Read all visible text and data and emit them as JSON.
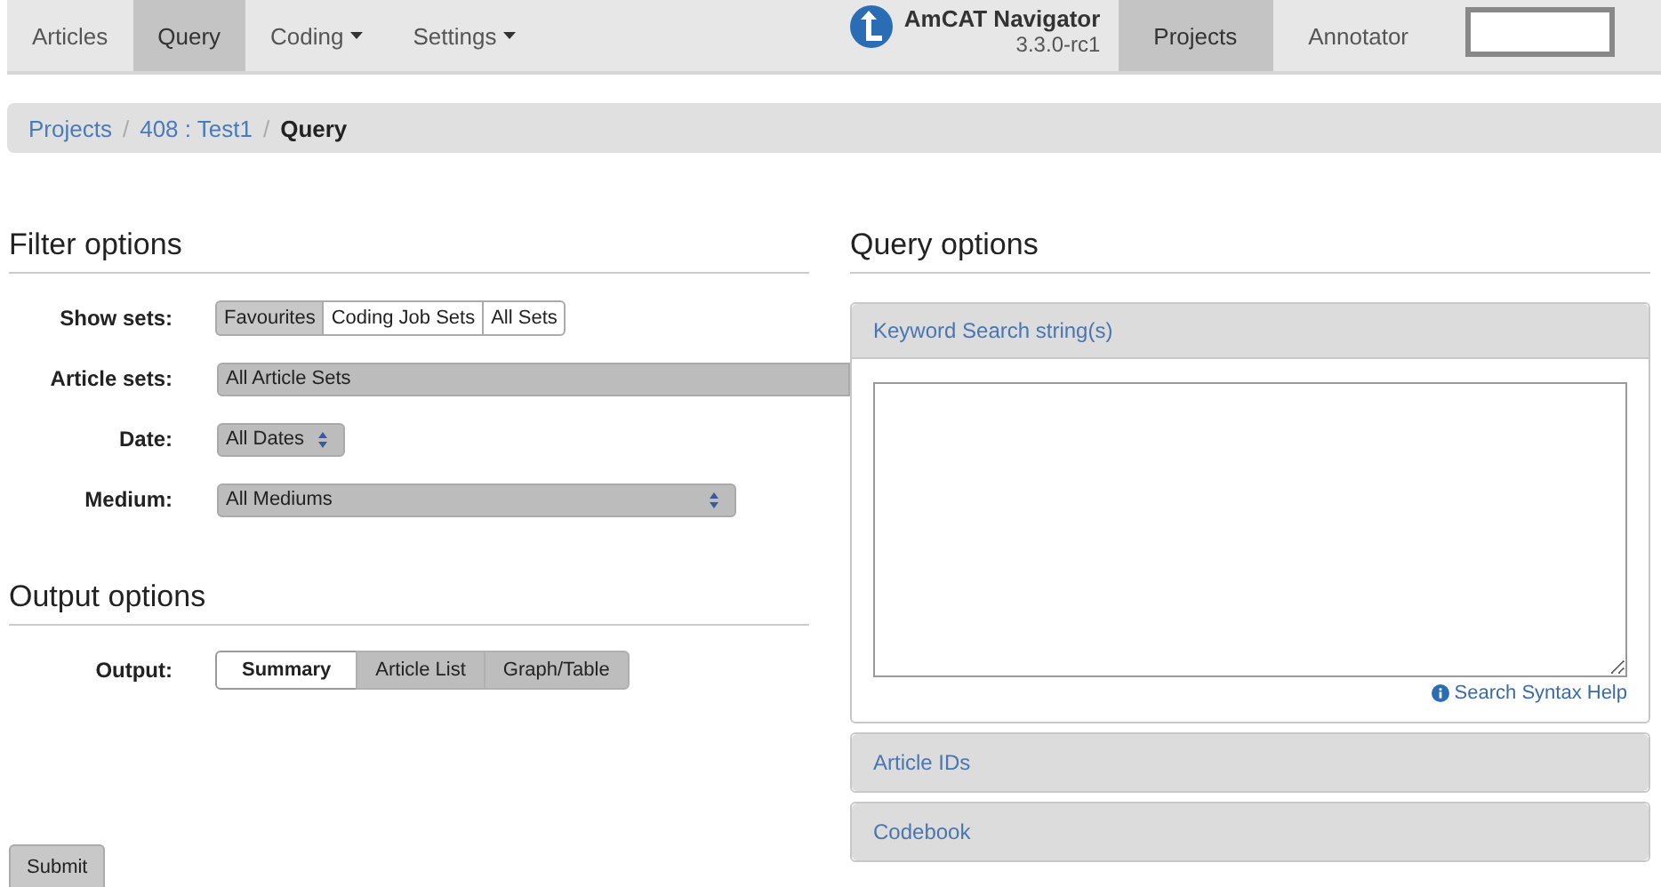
{
  "navbar": {
    "items": [
      {
        "label": "Articles",
        "selected": false,
        "dropdown": false
      },
      {
        "label": "Query",
        "selected": true,
        "dropdown": false
      },
      {
        "label": "Coding",
        "selected": false,
        "dropdown": true
      },
      {
        "label": "Settings",
        "selected": false,
        "dropdown": true
      }
    ],
    "brand": {
      "title": "AmCAT Navigator",
      "version": "3.3.0-rc1"
    },
    "right_items": [
      {
        "label": "Projects",
        "selected": true
      },
      {
        "label": "Annotator",
        "selected": false
      }
    ]
  },
  "breadcrumb": {
    "separator": "/",
    "items": [
      {
        "label": "Projects",
        "selected": false
      },
      {
        "label": "408 : Test1",
        "selected": false
      },
      {
        "label": "Query",
        "selected": true
      }
    ]
  },
  "filter": {
    "title": "Filter options",
    "fields": [
      {
        "kind": "sets",
        "label": "Show sets:",
        "options": [
          {
            "label": "Favourites",
            "selected": true
          },
          {
            "label": "Coding Job Sets",
            "selected": false
          },
          {
            "label": "All Sets",
            "selected": false
          }
        ]
      },
      {
        "kind": "multiselect",
        "label": "Article sets:",
        "value": "All Article Sets"
      },
      {
        "kind": "select",
        "label": "Date:",
        "value": "All Dates"
      },
      {
        "kind": "select",
        "label": "Medium:",
        "value": "All Mediums"
      }
    ]
  },
  "output": {
    "title": "Output options",
    "fields": [
      {
        "kind": "output",
        "label": "Output:",
        "options": [
          {
            "label": "Summary",
            "selected": true
          },
          {
            "label": "Article List",
            "selected": false
          },
          {
            "label": "Graph/Table",
            "selected": false
          }
        ]
      }
    ]
  },
  "submit": {
    "label": "Submit"
  },
  "query": {
    "title": "Query options",
    "panels": [
      {
        "title": "Keyword Search string(s)",
        "expanded": true,
        "help": "Search Syntax Help"
      },
      {
        "title": "Article IDs",
        "expanded": false
      },
      {
        "title": "Codebook",
        "expanded": false
      }
    ]
  }
}
